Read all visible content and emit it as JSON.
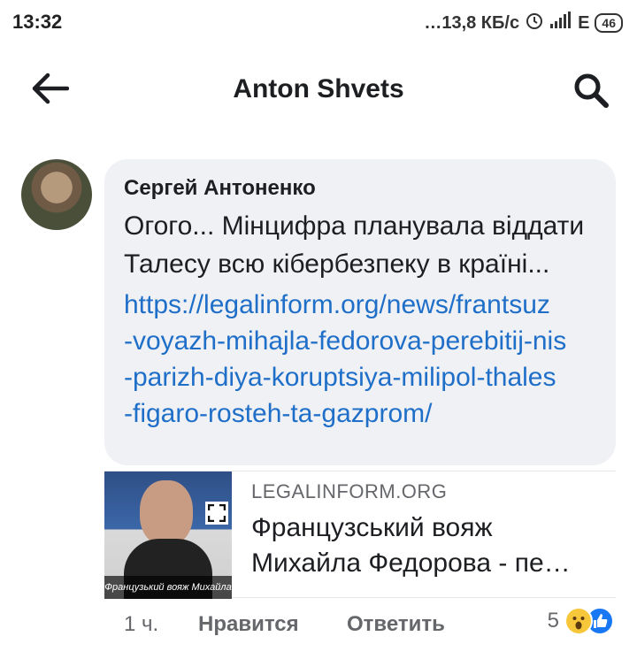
{
  "status_bar": {
    "time": "13:32",
    "speed": "…13,8 КБ/с",
    "network": "E",
    "battery": "46",
    "icons": [
      "alarm-icon",
      "signal-icon"
    ]
  },
  "header": {
    "title": "Anton Shvets",
    "back_icon": "arrow-left-icon",
    "search_icon": "search-icon"
  },
  "comment": {
    "author": "Сергей Антоненко",
    "text": "Огого... Мінцифра планувала віддати Талесу всю кібербезпеку в країні...",
    "link_lines": [
      "https://legalinform.org/news/frantsuz",
      "-voyazh-mihajla-fedorova-perebitij-nis",
      "-parizh-diya-koruptsiya-milipol-thales",
      "-figaro-rosteh-ta-gazprom/"
    ]
  },
  "preview": {
    "domain": "LEGALINFORM.ORG",
    "title": "Французський вояж Михайла Федорова - пе…",
    "thumbnail_caption": "Французький вояж Михайла"
  },
  "actions": {
    "time": "1 ч.",
    "like": "Нравится",
    "reply": "Ответить",
    "reaction_count": "5",
    "reaction_icons": [
      "wow-reaction-icon",
      "like-reaction-icon"
    ]
  },
  "colors": {
    "link": "#1f6fc9",
    "bubble": "#eff1f4",
    "secondary_text": "#65676b",
    "like_blue": "#1877f2"
  }
}
